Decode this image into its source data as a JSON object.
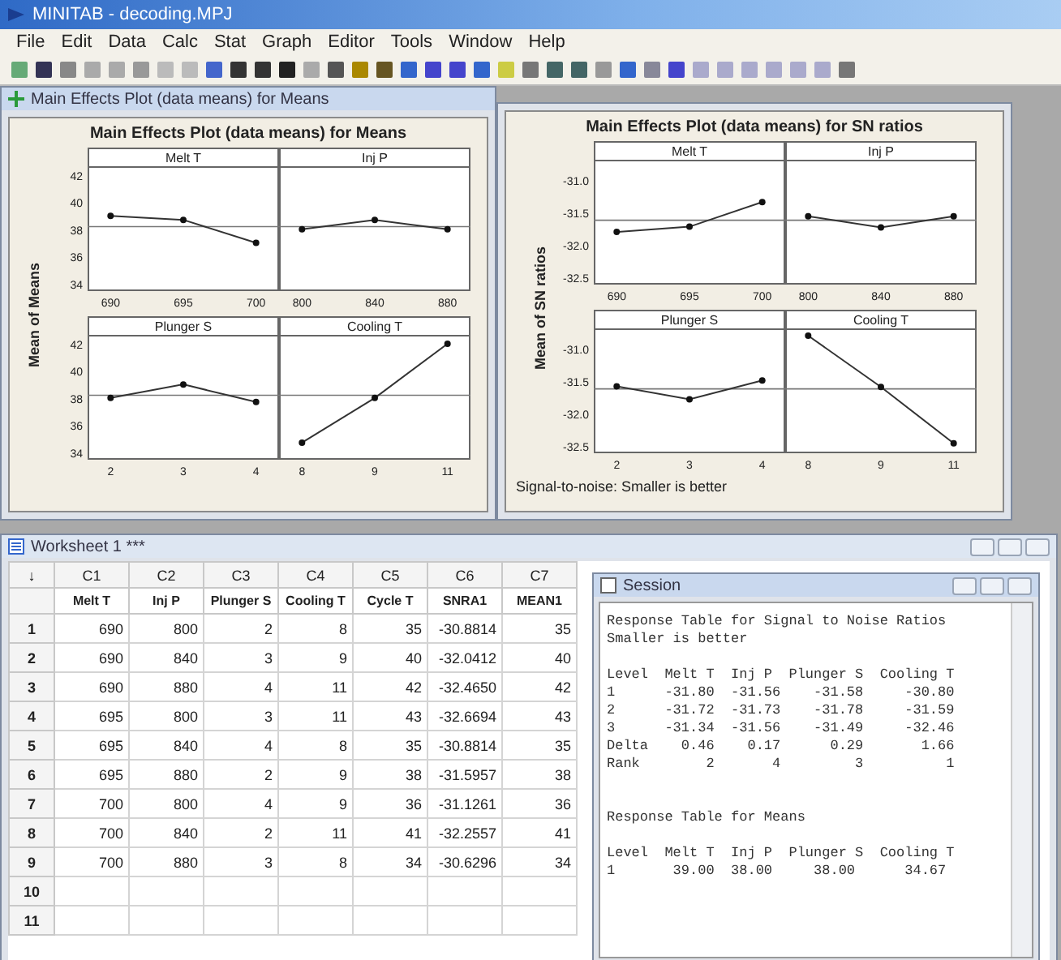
{
  "app": {
    "title": "MINITAB - decoding.MPJ",
    "menu": [
      "File",
      "Edit",
      "Data",
      "Calc",
      "Stat",
      "Graph",
      "Editor",
      "Tools",
      "Window",
      "Help"
    ]
  },
  "graphs": [
    {
      "window_title": "Main Effects Plot (data means) for Means",
      "title": "Main Effects Plot (data means) for Means",
      "ylabel": "Mean of Means",
      "panels": [
        {
          "chart_data": {
            "type": "line",
            "title": "Melt T",
            "categories": [
              "690",
              "695",
              "700"
            ],
            "series": [
              {
                "marker": "o",
                "values": [
                  39.0,
                  38.7,
                  37.0
                ]
              }
            ],
            "ref_lines": [
              {
                "axis": "y",
                "value": 38.2
              }
            ],
            "ylim": [
              33.5,
              42.6
            ],
            "yticks": [
              34,
              36,
              38,
              40,
              42
            ]
          }
        },
        {
          "chart_data": {
            "type": "line",
            "title": "Inj P",
            "categories": [
              "800",
              "840",
              "880"
            ],
            "series": [
              {
                "marker": "o",
                "values": [
                  38.0,
                  38.7,
                  38.0
                ]
              }
            ],
            "ref_lines": [
              {
                "axis": "y",
                "value": 38.2
              }
            ],
            "ylim": [
              33.5,
              42.6
            ]
          }
        },
        {
          "chart_data": {
            "type": "line",
            "title": "Plunger S",
            "categories": [
              "2",
              "3",
              "4"
            ],
            "series": [
              {
                "marker": "o",
                "values": [
                  38.0,
                  39.0,
                  37.7
                ]
              }
            ],
            "ref_lines": [
              {
                "axis": "y",
                "value": 38.2
              }
            ],
            "ylim": [
              33.5,
              42.6
            ],
            "yticks": [
              34,
              36,
              38,
              40,
              42
            ]
          }
        },
        {
          "chart_data": {
            "type": "line",
            "title": "Cooling T",
            "categories": [
              "8",
              "9",
              "11"
            ],
            "series": [
              {
                "marker": "o",
                "values": [
                  34.7,
                  38.0,
                  42.0
                ]
              }
            ],
            "ref_lines": [
              {
                "axis": "y",
                "value": 38.2
              }
            ],
            "ylim": [
              33.5,
              42.6
            ]
          }
        }
      ]
    },
    {
      "title": "Main Effects Plot (data means) for SN ratios",
      "ylabel": "Mean of SN ratios",
      "footnote": "Signal-to-noise: Smaller is better",
      "panels": [
        {
          "chart_data": {
            "type": "line",
            "title": "Melt T",
            "categories": [
              "690",
              "695",
              "700"
            ],
            "series": [
              {
                "marker": "o",
                "values": [
                  -31.8,
                  -31.72,
                  -31.34
                ]
              }
            ],
            "ref_lines": [
              {
                "axis": "y",
                "value": -31.62
              }
            ],
            "ylim": [
              -32.6,
              -30.7
            ],
            "yticks": [
              {
                "value": -31.0,
                "label": "-31.0"
              },
              {
                "value": -31.5,
                "label": "-31.5"
              },
              {
                "value": -32.0,
                "label": "-32.0"
              },
              {
                "value": -32.5,
                "label": "-32.5"
              }
            ]
          }
        },
        {
          "chart_data": {
            "type": "line",
            "title": "Inj P",
            "categories": [
              "800",
              "840",
              "880"
            ],
            "series": [
              {
                "marker": "o",
                "values": [
                  -31.56,
                  -31.73,
                  -31.56
                ]
              }
            ],
            "ref_lines": [
              {
                "axis": "y",
                "value": -31.62
              }
            ],
            "ylim": [
              -32.6,
              -30.7
            ]
          }
        },
        {
          "chart_data": {
            "type": "line",
            "title": "Plunger S",
            "categories": [
              "2",
              "3",
              "4"
            ],
            "series": [
              {
                "marker": "o",
                "values": [
                  -31.58,
                  -31.78,
                  -31.49
                ]
              }
            ],
            "ref_lines": [
              {
                "axis": "y",
                "value": -31.62
              }
            ],
            "ylim": [
              -32.6,
              -30.7
            ],
            "yticks": [
              {
                "value": -31.0,
                "label": "-31.0"
              },
              {
                "value": -31.5,
                "label": "-31.5"
              },
              {
                "value": -32.0,
                "label": "-32.0"
              },
              {
                "value": -32.5,
                "label": "-32.5"
              }
            ]
          }
        },
        {
          "chart_data": {
            "type": "line",
            "title": "Cooling T",
            "categories": [
              "8",
              "9",
              "11"
            ],
            "series": [
              {
                "marker": "o",
                "values": [
                  -30.8,
                  -31.59,
                  -32.46
                ]
              }
            ],
            "ref_lines": [
              {
                "axis": "y",
                "value": -31.62
              }
            ],
            "ylim": [
              -32.6,
              -30.7
            ]
          }
        }
      ]
    }
  ],
  "worksheet": {
    "title": "Worksheet 1 ***",
    "corner": "↓",
    "columns": [
      {
        "id": "C1",
        "name": "Melt T"
      },
      {
        "id": "C2",
        "name": "Inj P"
      },
      {
        "id": "C3",
        "name": "Plunger S"
      },
      {
        "id": "C4",
        "name": "Cooling T"
      },
      {
        "id": "C5",
        "name": "Cycle T"
      },
      {
        "id": "C6",
        "name": "SNRA1"
      },
      {
        "id": "C7",
        "name": "MEAN1"
      }
    ],
    "rows": [
      {
        "n": "1",
        "cells": [
          "690",
          "800",
          "2",
          "8",
          "35",
          "-30.8814",
          "35"
        ]
      },
      {
        "n": "2",
        "cells": [
          "690",
          "840",
          "3",
          "9",
          "40",
          "-32.0412",
          "40"
        ]
      },
      {
        "n": "3",
        "cells": [
          "690",
          "880",
          "4",
          "11",
          "42",
          "-32.4650",
          "42"
        ]
      },
      {
        "n": "4",
        "cells": [
          "695",
          "800",
          "3",
          "11",
          "43",
          "-32.6694",
          "43"
        ]
      },
      {
        "n": "5",
        "cells": [
          "695",
          "840",
          "4",
          "8",
          "35",
          "-30.8814",
          "35"
        ]
      },
      {
        "n": "6",
        "cells": [
          "695",
          "880",
          "2",
          "9",
          "38",
          "-31.5957",
          "38"
        ]
      },
      {
        "n": "7",
        "cells": [
          "700",
          "800",
          "4",
          "9",
          "36",
          "-31.1261",
          "36"
        ]
      },
      {
        "n": "8",
        "cells": [
          "700",
          "840",
          "2",
          "11",
          "41",
          "-32.2557",
          "41"
        ]
      },
      {
        "n": "9",
        "cells": [
          "700",
          "880",
          "3",
          "8",
          "34",
          "-30.6296",
          "34"
        ]
      },
      {
        "n": "10",
        "cells": []
      },
      {
        "n": "11",
        "cells": []
      }
    ]
  },
  "session": {
    "title": "Session",
    "blocks": [
      {
        "lines": [
          "Response Table for Signal to Noise Ratios",
          "Smaller is better"
        ]
      },
      {
        "lines": [
          "Level  Melt T  Inj P  Plunger S  Cooling T",
          "1      -31.80  -31.56    -31.58     -30.80",
          "2      -31.72  -31.73    -31.78     -31.59",
          "3      -31.34  -31.56    -31.49     -32.46",
          "Delta    0.46    0.17      0.29       1.66",
          "Rank        2       4         3          1"
        ]
      },
      {
        "lines": [
          "Response Table for Means"
        ]
      },
      {
        "lines": [
          "Level  Melt T  Inj P  Plunger S  Cooling T",
          "1       39.00  38.00     38.00      34.67"
        ]
      }
    ]
  }
}
